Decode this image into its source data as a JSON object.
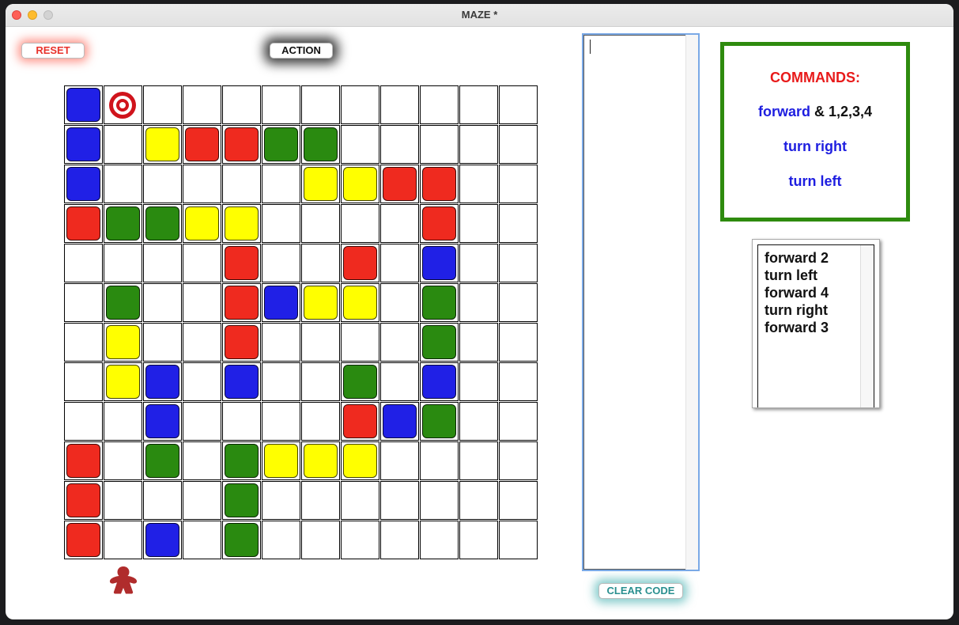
{
  "window": {
    "title": "MAZE *"
  },
  "buttons": {
    "reset": "RESET",
    "action": "ACTION",
    "clear_code": "CLEAR CODE"
  },
  "colors": {
    "blue": "#2020e6",
    "red": "#ef2a1f",
    "green": "#2a8a10",
    "yellow": "#ffff00",
    "target": "#d0141c",
    "player": "#b02c2c",
    "frame_green": "#2e8b0e",
    "command_blue": "#1e1ee0",
    "command_title": "#e81a1a"
  },
  "maze": {
    "rows": [
      "BT..........",
      "B.YRRGG.....",
      "B.....YYRR..",
      "RGGYY....R..",
      "....R..R.B..",
      ".G..RBYY.G..",
      ".Y..R....G..",
      ".YB.B..G.B..",
      "..B....RBG..",
      "R.G.GYYY....",
      "R...G.......",
      "R.B.G......."
    ],
    "player_column": 1
  },
  "code_editor": {
    "text": ""
  },
  "commands": {
    "title": "COMMANDS:",
    "forward": "forward",
    "forward_suffix": "& 1,2,3,4",
    "turn_right": "turn right",
    "turn_left": "turn left"
  },
  "program": [
    "forward 2",
    "turn left",
    "forward 4",
    "turn right",
    "forward 3"
  ]
}
